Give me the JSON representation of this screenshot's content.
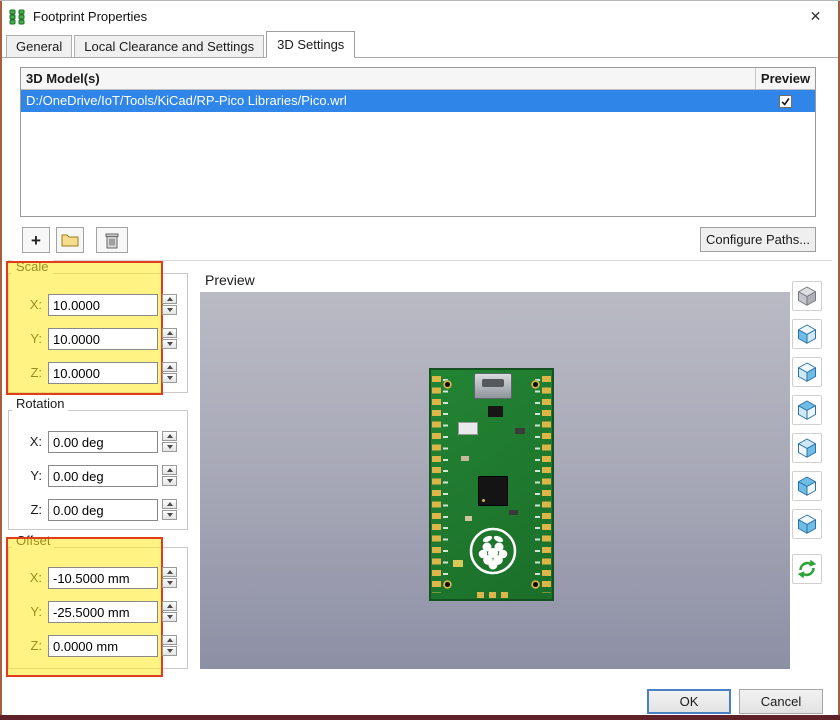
{
  "window": {
    "title": "Footprint Properties",
    "close_glyph": "✕"
  },
  "tabs": {
    "active_index": 2,
    "items": [
      {
        "label": "General"
      },
      {
        "label": "Local Clearance and Settings"
      },
      {
        "label": "3D Settings"
      }
    ]
  },
  "models": {
    "header_model": "3D Model(s)",
    "header_preview": "Preview",
    "rows": [
      {
        "path": "D:/OneDrive/IoT/Tools/KiCad/RP-Pico Libraries/Pico.wrl",
        "preview_checked": true
      }
    ],
    "add_label": "+",
    "configure_paths_label": "Configure Paths..."
  },
  "transform": {
    "scale": {
      "title": "Scale",
      "rows": [
        {
          "label": "X:",
          "value": "10.0000"
        },
        {
          "label": "Y:",
          "value": "10.0000"
        },
        {
          "label": "Z:",
          "value": "10.0000"
        }
      ]
    },
    "rotation": {
      "title": "Rotation",
      "rows": [
        {
          "label": "X:",
          "value": "0.00 deg"
        },
        {
          "label": "Y:",
          "value": "0.00 deg"
        },
        {
          "label": "Z:",
          "value": "0.00 deg"
        }
      ]
    },
    "offset": {
      "title": "Offset",
      "rows": [
        {
          "label": "X:",
          "value": "-10.5000 mm"
        },
        {
          "label": "Y:",
          "value": "-25.5000 mm"
        },
        {
          "label": "Z:",
          "value": "0.0000 mm"
        }
      ]
    }
  },
  "preview": {
    "title": "Preview"
  },
  "footer": {
    "ok": "OK",
    "cancel": "Cancel"
  },
  "icons": {
    "app": "footprint-pads-icon",
    "titlebar_close": "close-x-icon",
    "add": "plus-icon",
    "folder": "folder-icon",
    "delete": "trash-icon",
    "view_cubes": "cube-view-icons",
    "reload": "green-refresh-icon",
    "preview_check": "checkmark-icon"
  },
  "colors": {
    "selection": "#2f86e8",
    "highlight_fill": "#ffeb1e",
    "highlight_border": "#e23c1e",
    "board_green": "#1e7a2d",
    "preview_top": "#b9bac4",
    "preview_bottom": "#8d8fa5"
  }
}
